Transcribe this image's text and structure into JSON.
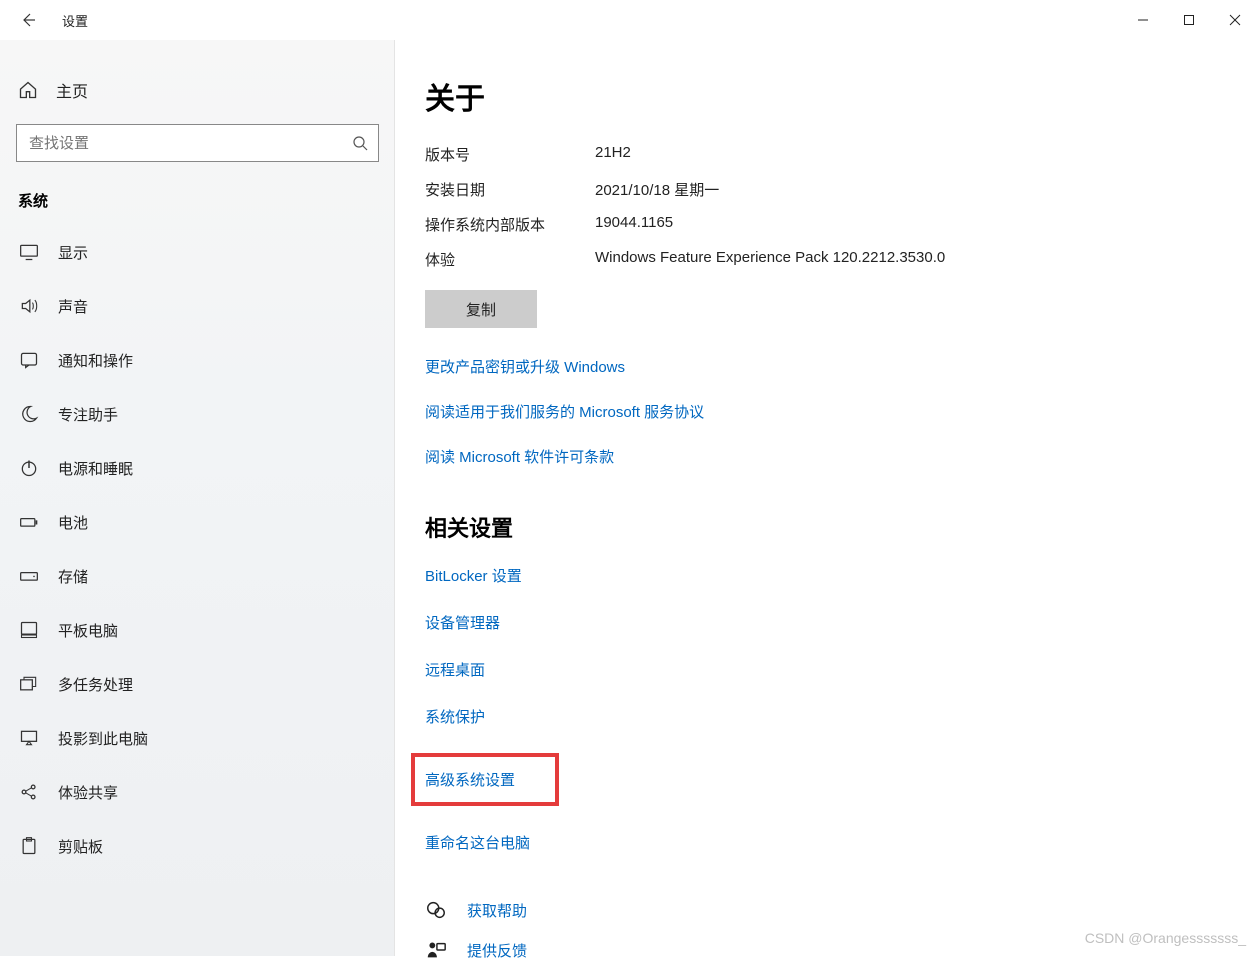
{
  "titlebar": {
    "title": "设置"
  },
  "sidebar": {
    "home": "主页",
    "search_placeholder": "查找设置",
    "section": "系统",
    "items": [
      {
        "label": "显示"
      },
      {
        "label": "声音"
      },
      {
        "label": "通知和操作"
      },
      {
        "label": "专注助手"
      },
      {
        "label": "电源和睡眠"
      },
      {
        "label": "电池"
      },
      {
        "label": "存储"
      },
      {
        "label": "平板电脑"
      },
      {
        "label": "多任务处理"
      },
      {
        "label": "投影到此电脑"
      },
      {
        "label": "体验共享"
      },
      {
        "label": "剪贴板"
      }
    ]
  },
  "content": {
    "title": "关于",
    "specs": [
      {
        "label": "版本号",
        "value": "21H2"
      },
      {
        "label": "安装日期",
        "value": "2021/10/18 星期一"
      },
      {
        "label": "操作系统内部版本",
        "value": "19044.1165"
      },
      {
        "label": "体验",
        "value": "Windows Feature Experience Pack 120.2212.3530.0"
      }
    ],
    "copy_button": "复制",
    "links": [
      "更改产品密钥或升级 Windows",
      "阅读适用于我们服务的 Microsoft 服务协议",
      "阅读 Microsoft 软件许可条款"
    ],
    "related_title": "相关设置",
    "related_links": [
      "BitLocker 设置",
      "设备管理器",
      "远程桌面",
      "系统保护",
      "高级系统设置",
      "重命名这台电脑"
    ],
    "highlighted_index": 4,
    "footer": [
      {
        "label": "获取帮助"
      },
      {
        "label": "提供反馈"
      }
    ]
  },
  "watermark": "CSDN @Orangesssssss_"
}
